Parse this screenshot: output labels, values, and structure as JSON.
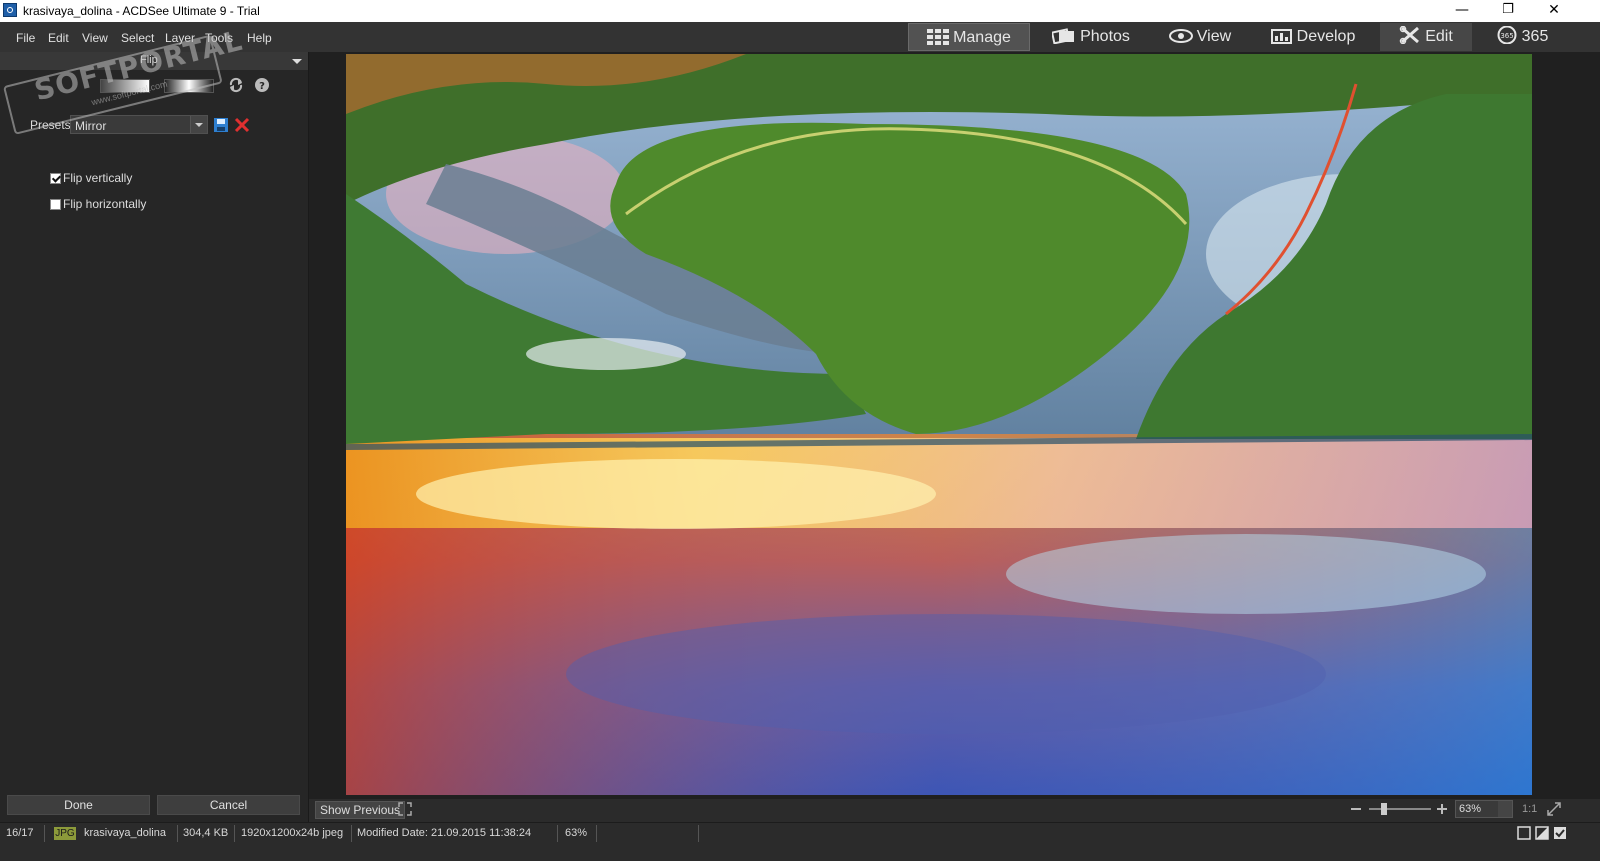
{
  "window": {
    "title": "krasivaya_dolina - ACDSee Ultimate 9 - Trial",
    "minimize": "—",
    "maximize": "❐",
    "close": "✕"
  },
  "menu": [
    "File",
    "Edit",
    "View",
    "Select",
    "Layer",
    "Tools",
    "Help"
  ],
  "modes": [
    {
      "label": "Manage",
      "icon": "grid-icon",
      "active": true
    },
    {
      "label": "Photos",
      "icon": "photos-icon",
      "active": false
    },
    {
      "label": "View",
      "icon": "eye-icon",
      "active": false
    },
    {
      "label": "Develop",
      "icon": "develop-icon",
      "active": false
    },
    {
      "label": "Edit",
      "icon": "edit-icon",
      "active": false
    },
    {
      "label": "365",
      "icon": "cloud-365-icon",
      "active": false
    }
  ],
  "panel": {
    "title": "Flip",
    "presets_label": "Presets",
    "preset_value": "Mirror",
    "options": [
      {
        "label": "Flip vertically",
        "checked": true
      },
      {
        "label": "Flip horizontally",
        "checked": false
      }
    ],
    "done": "Done",
    "cancel": "Cancel"
  },
  "watermark": {
    "main": "SOFTPORTAL",
    "sub": "www.softportal.com"
  },
  "viewer": {
    "show_previous": "Show Previous",
    "zoom": "63%",
    "one_to_one": "1:1"
  },
  "status": {
    "position": "16/17",
    "format": "JPG",
    "filename": "krasivaya_dolina",
    "size": "304,4 KB",
    "dimensions": "1920x1200x24b jpeg",
    "modified": "Modified Date: 21.09.2015 11:38:24",
    "zoom": "63%"
  },
  "colors": {
    "accent": "#525252",
    "bg": "#2b2b2b",
    "panel": "#262626"
  }
}
